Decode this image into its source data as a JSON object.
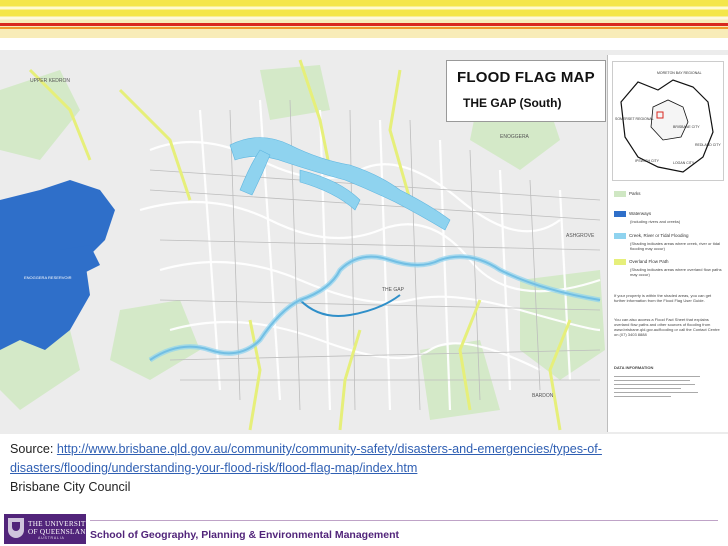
{
  "map": {
    "title": "FLOOD FLAG MAP",
    "subtitle": "THE GAP (South)",
    "place_labels": [
      "UPPER KEDRON",
      "ENOGGERA",
      "THE GAP",
      "ASHGROVE",
      "BARDON",
      "ENOGGERA RESERVOIR"
    ],
    "inset_labels": [
      "MORETON BAY REGIONAL",
      "BRISBANE CITY",
      "IPSWICH CITY",
      "LOGAN CITY",
      "REDLAND CITY",
      "SOMERSET REGIONAL"
    ],
    "legend": {
      "items": [
        {
          "label": "Parks",
          "color": "#cfe7c3"
        },
        {
          "label": "Waterways",
          "note": "(Including rivers and creeks)",
          "color": "#2f6fc9"
        },
        {
          "label": "Creek, River or Tidal Flooding",
          "note": "(Shading indicates areas where creek, river or tidal flooding may occur)",
          "color": "#8fd3ef"
        },
        {
          "label": "Overland Flow Path",
          "note": "(Shading indicates areas where overland flow paths may occur)",
          "color": "#e6ef7a"
        }
      ],
      "note_1": "If your property is within the shaded areas, you can get further information from the Flood Flag User Guide.",
      "note_2": "You can also access a Flood Fact Sheet that explains overland flow paths and other sources of flooding from www.brisbane.qld.gov.au/flooding or call the Contact Centre on (07) 3403 8888",
      "data_information_heading": "DATA INFORMATION"
    }
  },
  "caption": {
    "source_prefix": "Source: ",
    "url": "http://www.brisbane.qld.gov.au/community/community-safety/disasters-and-emergencies/types-of-disasters/flooding/understanding-your-flood-risk/flood-flag-map/index.htm",
    "url_line1": "http://www.brisbane.qld.gov.au/community/community-safety/disasters-and-emergencies/types-of-",
    "url_line2": "disasters/flooding/understanding-your-flood-risk/flood-flag-map/index.htm",
    "attribution": "Brisbane City Council"
  },
  "footer": {
    "logo_line1": "THE UNIVERSITY",
    "logo_line2": "OF QUEENSLAND",
    "logo_line3": "AUSTRALIA",
    "school": "School of Geography, Planning & Environmental Management"
  },
  "colors": {
    "accent_purple": "#51247a",
    "link_blue": "#2f5fb3",
    "flood_light_blue": "#8fd3ef",
    "waterway_blue": "#2f6fc9",
    "overland_yellow": "#e6ef7a",
    "park_green": "#cfe7c3",
    "top_bar_yellow": "#f4e64a",
    "top_bar_red": "#d9281e"
  }
}
